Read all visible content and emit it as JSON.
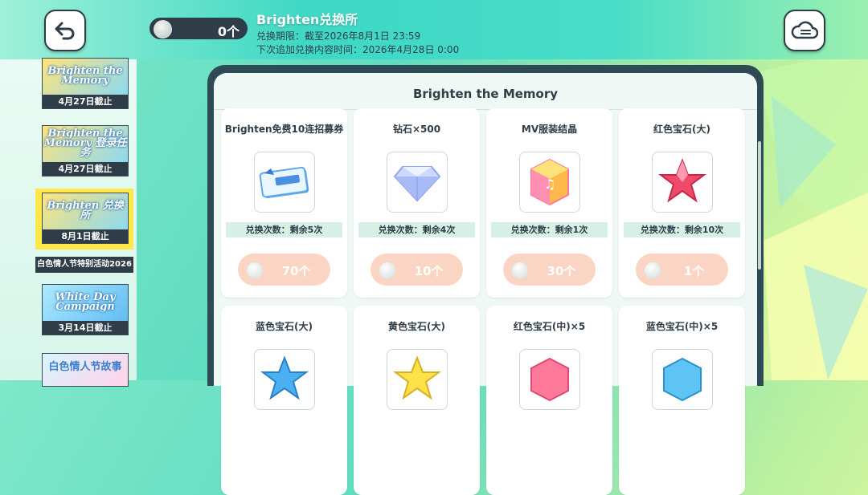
{
  "header": {
    "currency_amount": "0个",
    "shop_title": "Brighten兑换所",
    "period_line": "兑换期限：截至2026年8月1日 23:59",
    "next_add_line": "下次追加兑换内容时间：2026年4月28日 0:00"
  },
  "buttons": {
    "back_icon": "back-arrow-icon",
    "cloud_icon": "cloud-menu-icon"
  },
  "sidebar": {
    "banners": [
      {
        "title": "Brighten the Memory",
        "caption": "4月27日截止"
      },
      {
        "title": "Brighten the Memory 登录任务",
        "caption": "4月27日截止"
      },
      {
        "title": "Brighten 兑换所",
        "caption": "8月1日截止"
      },
      {
        "title": "White Day Campaign",
        "caption": "3月14日截止"
      },
      {
        "title": "白色情人节故事",
        "caption": ""
      }
    ],
    "event_label": "白色情人节特别活动2026"
  },
  "panel": {
    "title": "Brighten the Memory"
  },
  "items": [
    {
      "name": "Brighten免费10连招募券",
      "limit": "兑换次数：剩余5次",
      "price": "70个"
    },
    {
      "name": "钻石×500",
      "limit": "兑换次数：剩余4次",
      "price": "10个"
    },
    {
      "name": "MV服装结晶",
      "limit": "兑换次数：剩余1次",
      "price": "30个"
    },
    {
      "name": "红色宝石(大)",
      "limit": "兑换次数：剩余10次",
      "price": "1个"
    },
    {
      "name": "蓝色宝石(大)"
    },
    {
      "name": "黄色宝石(大)"
    },
    {
      "name": "红色宝石(中)×5"
    },
    {
      "name": "蓝色宝石(中)×5"
    }
  ],
  "colors": {
    "accent": "#2e3d48",
    "button_fill": "#fbd3c0",
    "limit_bg": "#d6f0e6"
  }
}
